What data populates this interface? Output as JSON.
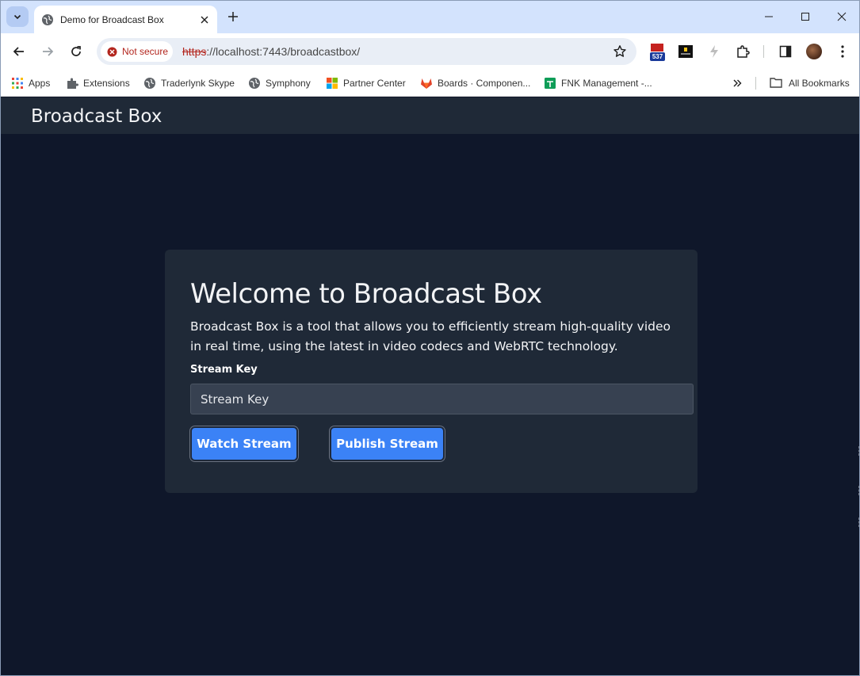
{
  "browser": {
    "tab": {
      "title": "Demo for Broadcast Box"
    },
    "security_chip": "Not secure",
    "url": {
      "scheme": "https",
      "rest": "://localhost:7443/broadcastbox/"
    },
    "extension_badge": "537",
    "bookmarks": [
      {
        "label": "Apps",
        "icon": "apps-grid-icon"
      },
      {
        "label": "Extensions",
        "icon": "puzzle-icon"
      },
      {
        "label": "Traderlynk Skype",
        "icon": "globe-icon"
      },
      {
        "label": "Symphony",
        "icon": "globe-icon"
      },
      {
        "label": "Partner Center",
        "icon": "microsoft-icon"
      },
      {
        "label": "Boards · Componen...",
        "icon": "gitlab-icon"
      },
      {
        "label": "FNK Management -...",
        "icon": "sheets-icon"
      }
    ],
    "all_bookmarks": "All Bookmarks"
  },
  "app": {
    "brand": "Broadcast Box",
    "heading": "Welcome to Broadcast Box",
    "description": "Broadcast Box is a tool that allows you to efficiently stream high-quality video in real time, using the latest in video codecs and WebRTC technology.",
    "stream_key_label": "Stream Key",
    "stream_key_placeholder": "Stream Key",
    "watch_button": "Watch Stream",
    "publish_button": "Publish Stream"
  },
  "colors": {
    "page_bg": "#0f172a",
    "navbar_bg": "#1f2937",
    "card_bg": "#1f2937",
    "input_bg": "#374151",
    "button_bg": "#3b82f6",
    "tabstrip_bg": "#d3e3fd"
  }
}
